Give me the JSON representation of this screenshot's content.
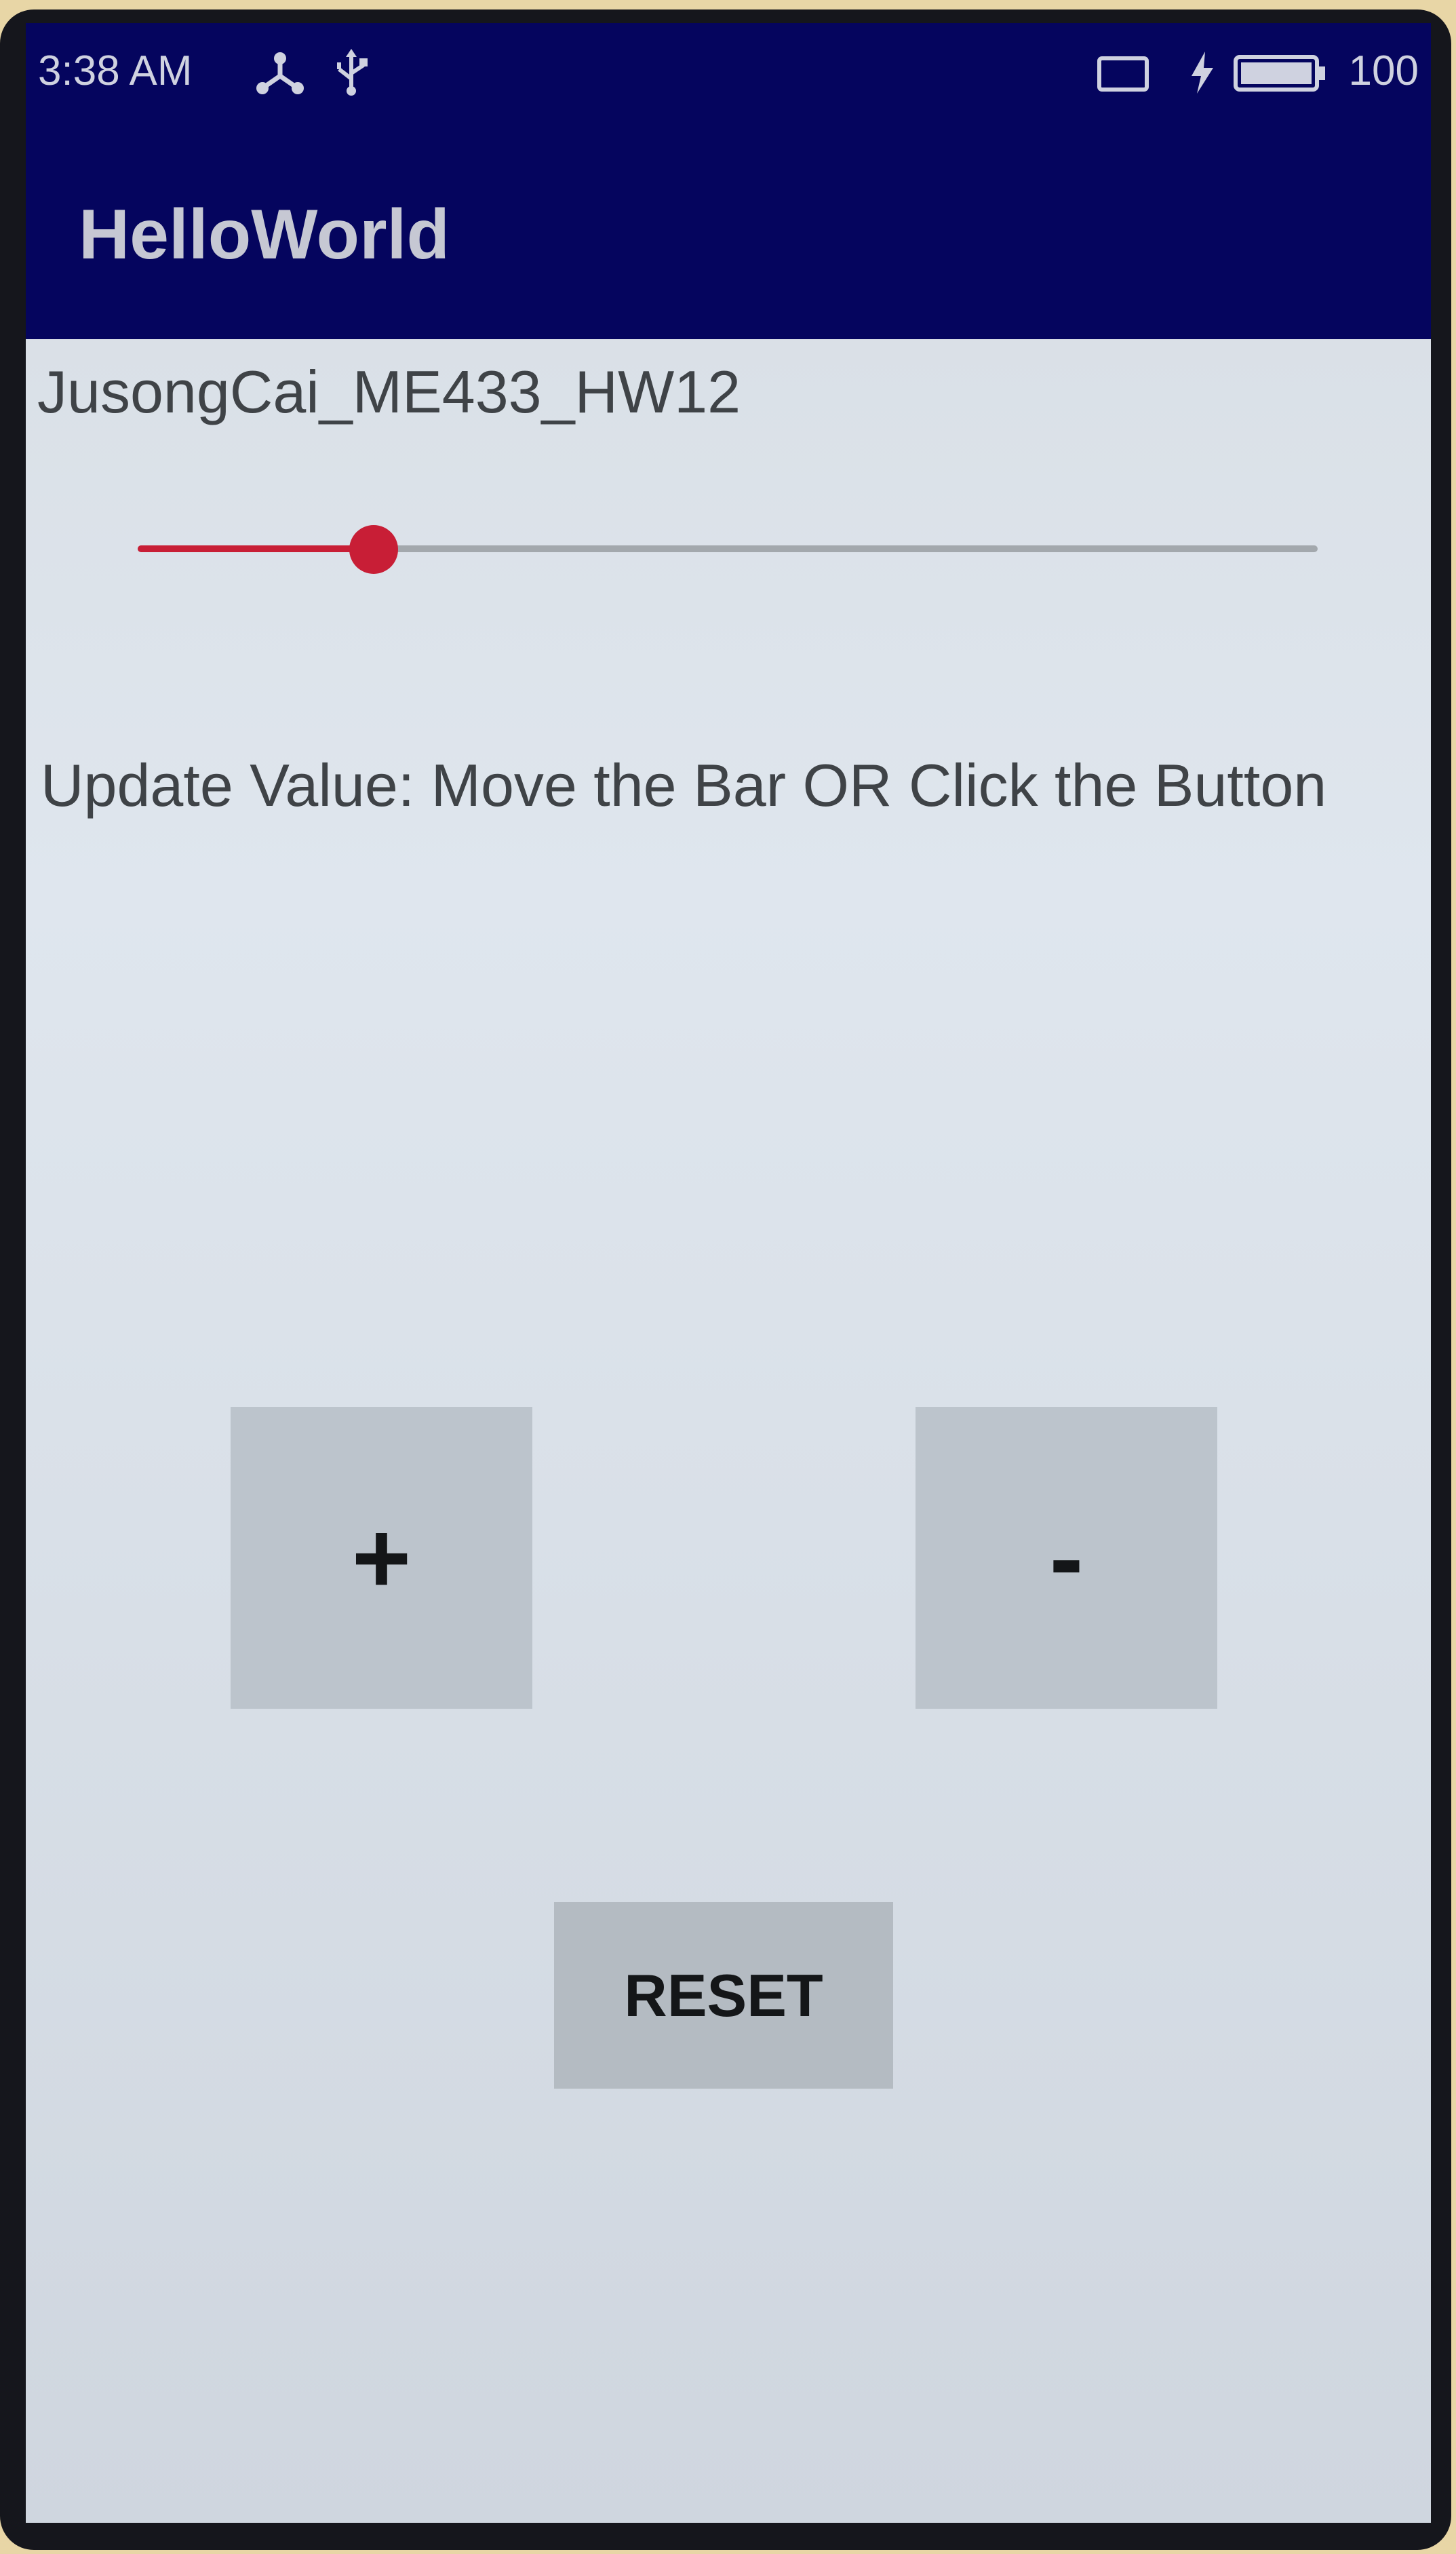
{
  "status_bar": {
    "time": "3:38 AM",
    "icons_left": [
      "usb-tether-icon",
      "usb-icon"
    ],
    "icons_right": [
      "cast-icon",
      "charging-icon",
      "battery-icon"
    ],
    "battery_level": "100"
  },
  "app_bar": {
    "title": "HelloWorld",
    "color": "#05055e"
  },
  "main": {
    "title": "JusongCai_ME433_HW12",
    "seekbar": {
      "progress": 0.2,
      "accent_color": "#c81e36"
    },
    "update_label": "Update Value: Move the Bar OR Click the Button",
    "plus_label": "+",
    "minus_label": "-",
    "reset_label": "RESET"
  }
}
